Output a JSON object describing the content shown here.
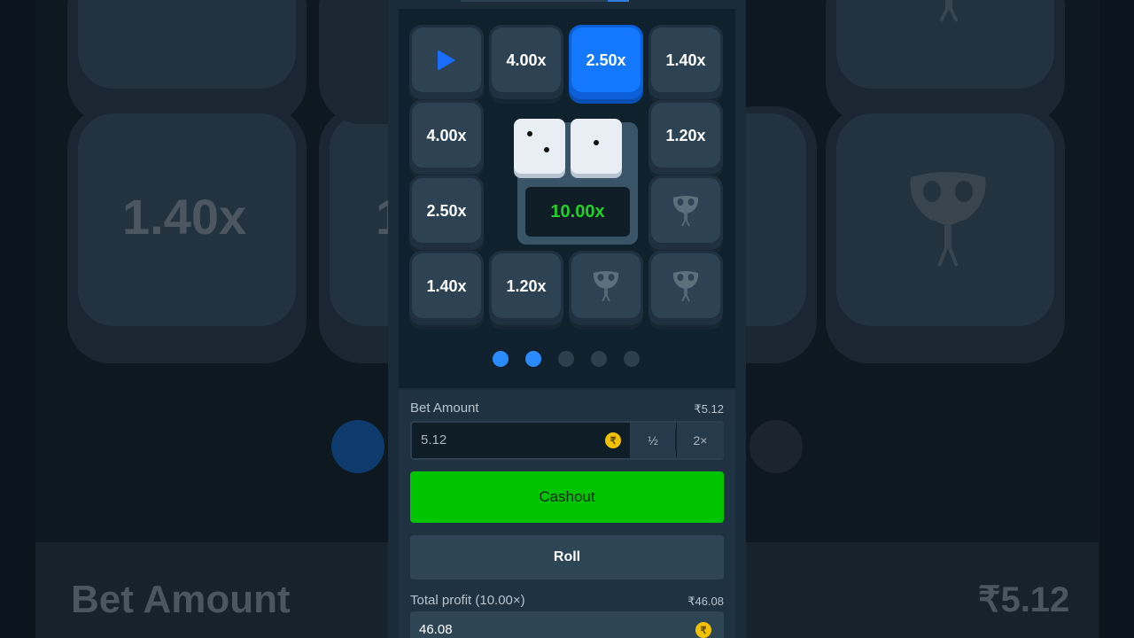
{
  "tiles": [
    {
      "label": "",
      "icon": "play-icon",
      "active": false
    },
    {
      "label": "4.00x",
      "active": false
    },
    {
      "label": "2.50x",
      "active": true
    },
    {
      "label": "1.40x",
      "active": false
    },
    {
      "label": "4.00x",
      "active": false
    },
    {
      "label": "1.20x",
      "active": false
    },
    {
      "label": "2.50x",
      "active": false
    },
    {
      "label": "",
      "icon": "skull-icon",
      "active": false
    },
    {
      "label": "1.40x",
      "active": false
    },
    {
      "label": "1.20x",
      "active": false
    },
    {
      "label": "",
      "icon": "skull-icon",
      "active": false
    },
    {
      "label": "",
      "icon": "skull-icon",
      "active": false
    }
  ],
  "dice": [
    2,
    1
  ],
  "current_multiplier": "10.00x",
  "pagination": {
    "total": 5,
    "active_count": 2
  },
  "bet": {
    "label": "Bet Amount",
    "balance": "₹5.12",
    "value": "5.12",
    "currency_symbol": "₹",
    "half_label": "½",
    "double_label": "2×"
  },
  "cashout_label": "Cashout",
  "roll_label": "Roll",
  "profit": {
    "label": "Total profit (10.00×)",
    "amount": "₹46.08",
    "value": "46.08",
    "currency_symbol": "₹"
  },
  "background": {
    "tile_text_left": "1.40x",
    "tile_text_partial": "1",
    "bet_label": "Bet Amount",
    "balance": "₹5.12"
  },
  "colors": {
    "accent_blue": "#1478ff",
    "cashout_green": "#00c400",
    "multiplier_green": "#22d02a",
    "coin_yellow": "#f2c200"
  }
}
